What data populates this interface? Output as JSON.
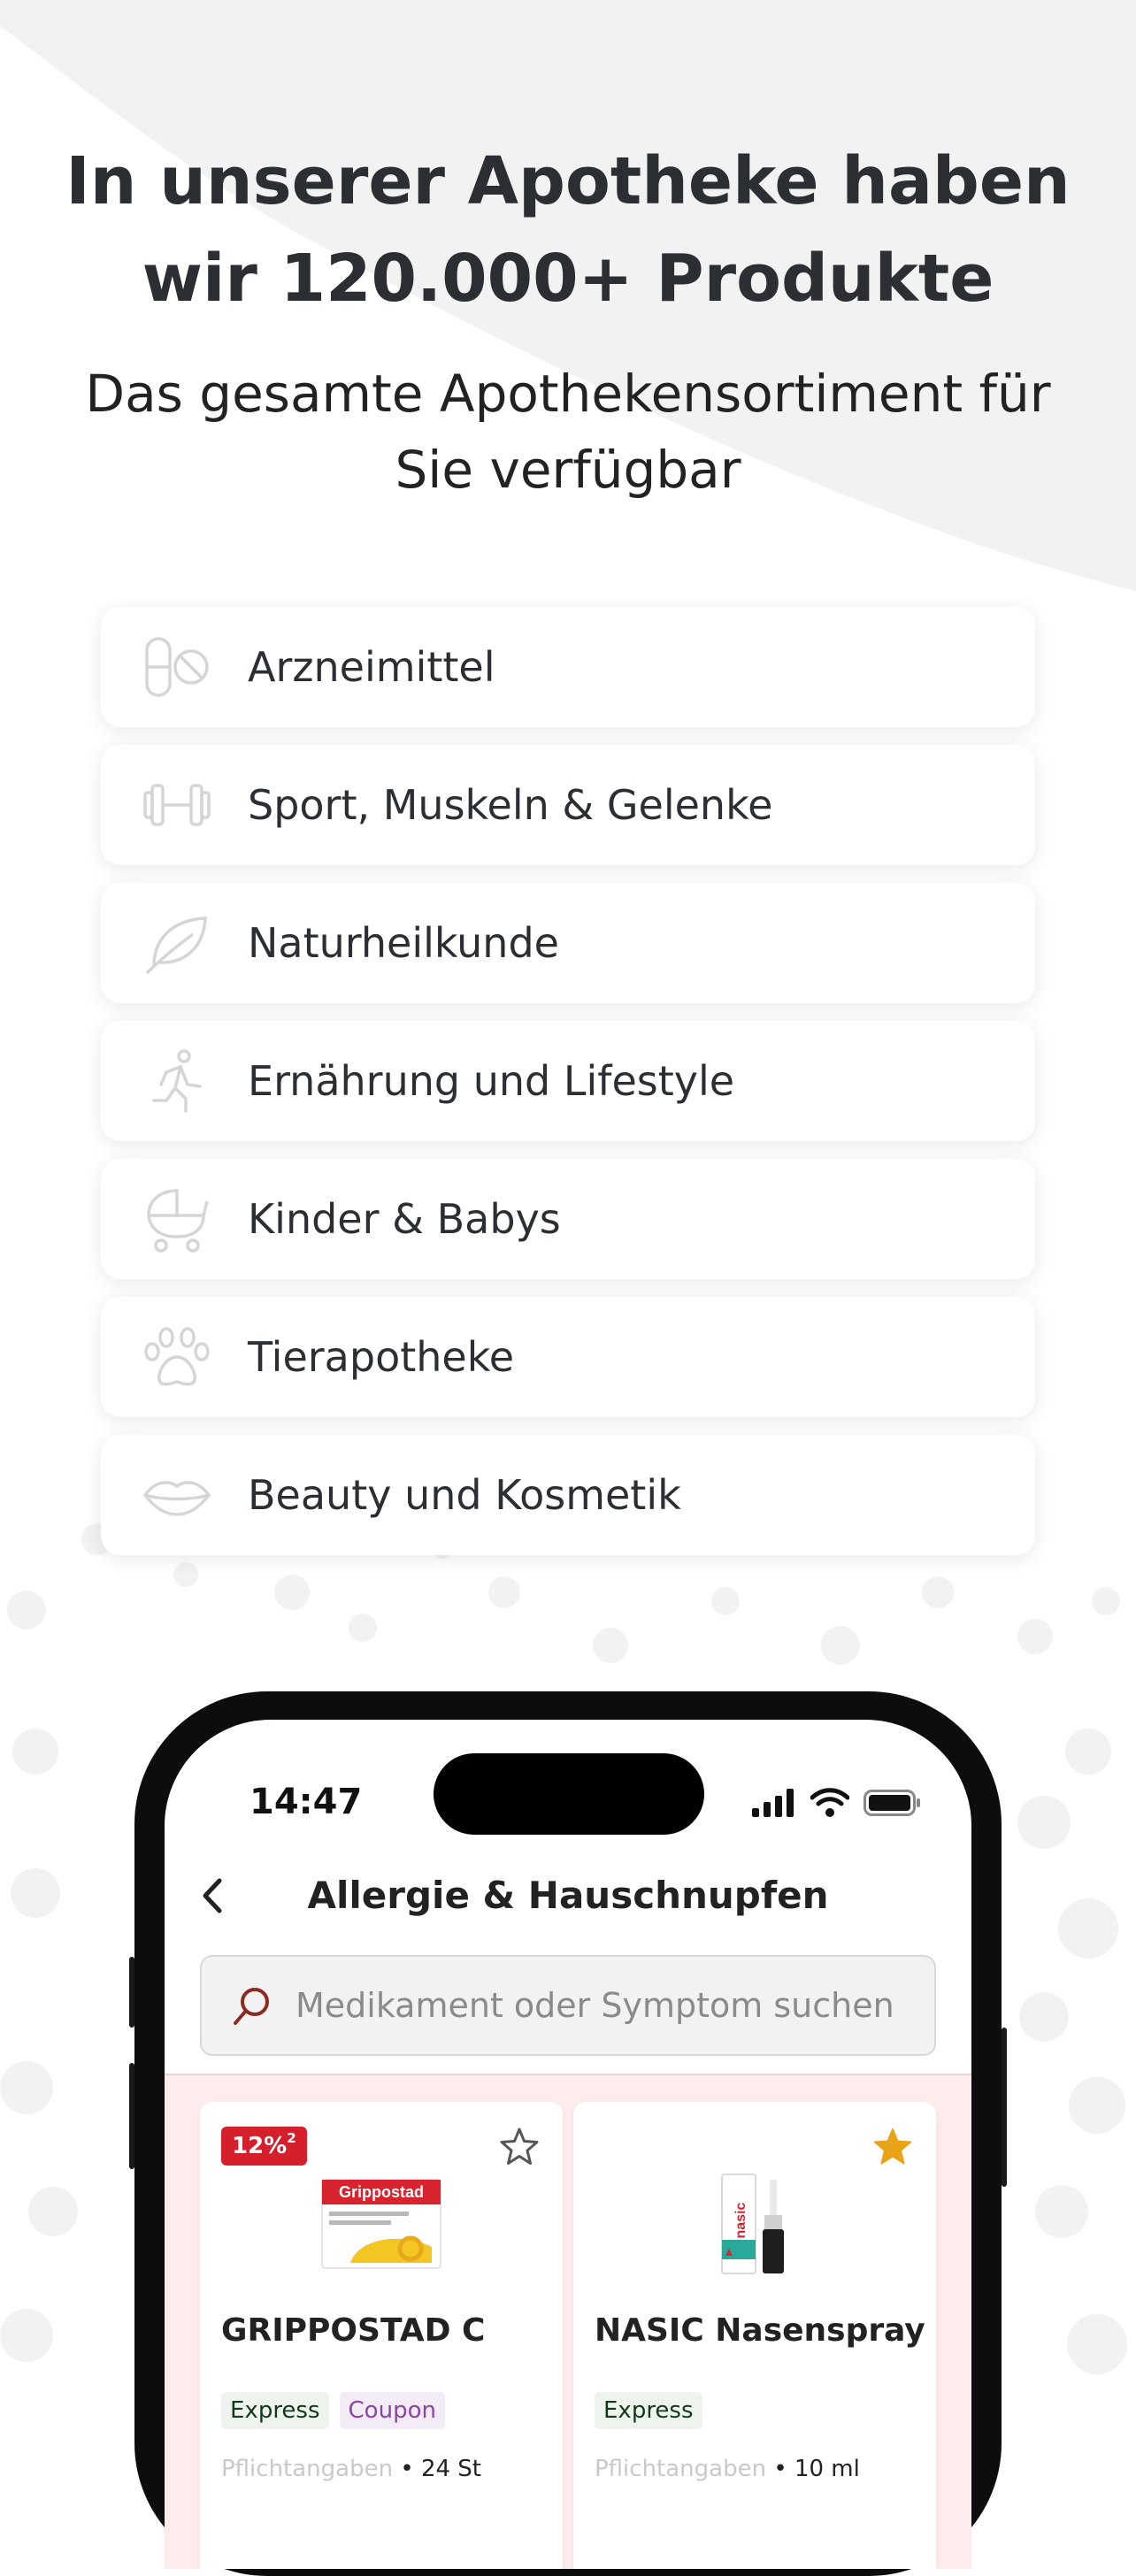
{
  "hero": {
    "title_line1": "In unserer Apotheke haben",
    "title_line2": "wir 120.000+ Produkte",
    "subtitle": "Das gesamte Apothekensortiment für Sie verfügbar"
  },
  "categories": [
    {
      "label": "Arzneimittel",
      "icon": "pill-icon"
    },
    {
      "label": "Sport, Muskeln & Gelenke",
      "icon": "dumbbell-icon"
    },
    {
      "label": "Naturheilkunde",
      "icon": "leaf-icon"
    },
    {
      "label": "Ernährung und Lifestyle",
      "icon": "running-person-icon"
    },
    {
      "label": "Kinder & Babys",
      "icon": "stroller-icon"
    },
    {
      "label": "Tierapotheke",
      "icon": "paw-icon"
    },
    {
      "label": "Beauty und Kosmetik",
      "icon": "lips-icon"
    }
  ],
  "phone": {
    "status": {
      "time": "14:47"
    },
    "nav": {
      "title": "Allergie & Hauschnupfen"
    },
    "search": {
      "placeholder": "Medikament oder Symptom suchen"
    },
    "products": [
      {
        "name": "GRIPPOSTAD C",
        "discount": "12%",
        "discount_note": "2",
        "favorite": false,
        "tags": [
          "Express",
          "Coupon"
        ],
        "meta_label": "Pflichtangaben",
        "meta_value": "• 24 St",
        "image_label": "Grippostad"
      },
      {
        "name": "NASIC Nasenspray",
        "favorite": true,
        "tags": [
          "Express"
        ],
        "meta_label": "Pflichtangaben",
        "meta_value": "• 10 ml",
        "image_label": "nasic"
      }
    ]
  },
  "colors": {
    "accent_red": "#d51f2b",
    "favorite_star": "#e8a317",
    "list_background": "#fdecec",
    "coupon_purple": "#8a45a5"
  }
}
